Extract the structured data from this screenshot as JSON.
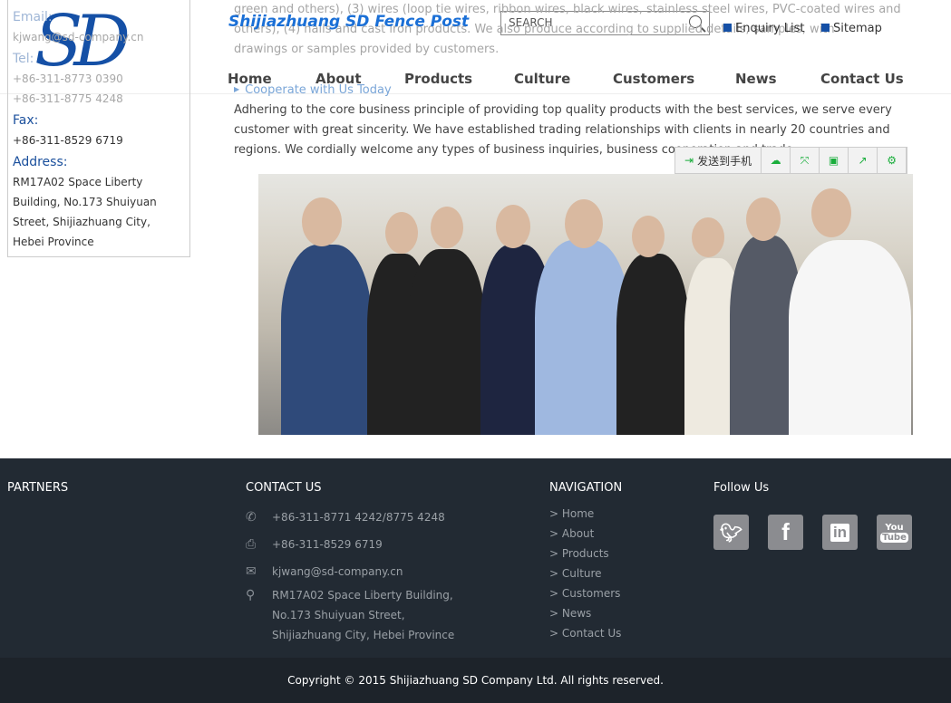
{
  "sidebar": {
    "email_label": "Email:",
    "email": "kjwang@sd-company.cn",
    "tel_label": "Tel:",
    "tel1": "+86-311-8773 0390",
    "tel2": "+86-311-8775 4248",
    "fax_label": "Fax:",
    "fax": "+86-311-8529 6719",
    "address_label": "Address:",
    "address": "RM17A02 Space Liberty Building, No.173 Shuiyuan Street, Shijiazhuang City, Hebei Province"
  },
  "main": {
    "bg_lines": [
      "green and others), (3) wires (loop tie wires, ribbon wires, black wires, stainless steel wires, PVC-coated wires and",
      "others), (4) nails and cast iron products. We also produce according to supplied details, samples, with",
      "drawings or samples provided by customers."
    ],
    "cooperate": "Cooperate with Us Today",
    "paragraph": "Adhering to the core business principle of providing top quality products with the best services, we serve every customer with great sincerity. We have established trading relationships with clients in nearly 20 countries and regions. We cordially welcome any types of business inquiries, business cooperation and trade."
  },
  "header": {
    "logo": "SD",
    "title": "Shijiazhuang SD Fence Post",
    "search_placeholder": "SEARCH",
    "enquiry": "Enquiry List",
    "sitemap": "Sitemap",
    "nav": [
      "Home",
      "About",
      "Products",
      "Culture",
      "Customers",
      "News",
      "Contact Us"
    ]
  },
  "toolbar": {
    "send_to_phone": "发送到手机"
  },
  "footer": {
    "partners": "PARTNERS",
    "contact_title": "CONTACT US",
    "phone": "+86-311-8771 4242/8775 4248",
    "fax": "+86-311-8529 6719",
    "email": "kjwang@sd-company.cn",
    "address": [
      "RM17A02 Space Liberty Building,",
      "No.173 Shuiyuan Street,",
      "Shijiazhuang City, Hebei Province"
    ],
    "nav_title": "NAVIGATION",
    "nav": [
      "> Home",
      "> About",
      "> Products",
      "> Culture",
      "> Customers",
      "> News",
      "> Contact Us"
    ],
    "follow_title": "Follow Us",
    "social": [
      "twitter",
      "facebook",
      "linkedin",
      "youtube"
    ],
    "copyright": "Copyright © 2015 Shijiazhuang SD Company Ltd. All rights reserved."
  },
  "colors": {
    "brand": "#1550a6",
    "footer_bg": "#222a33",
    "copyright_bg": "#1d232a",
    "toolbar_icon": "#1aae3c"
  }
}
